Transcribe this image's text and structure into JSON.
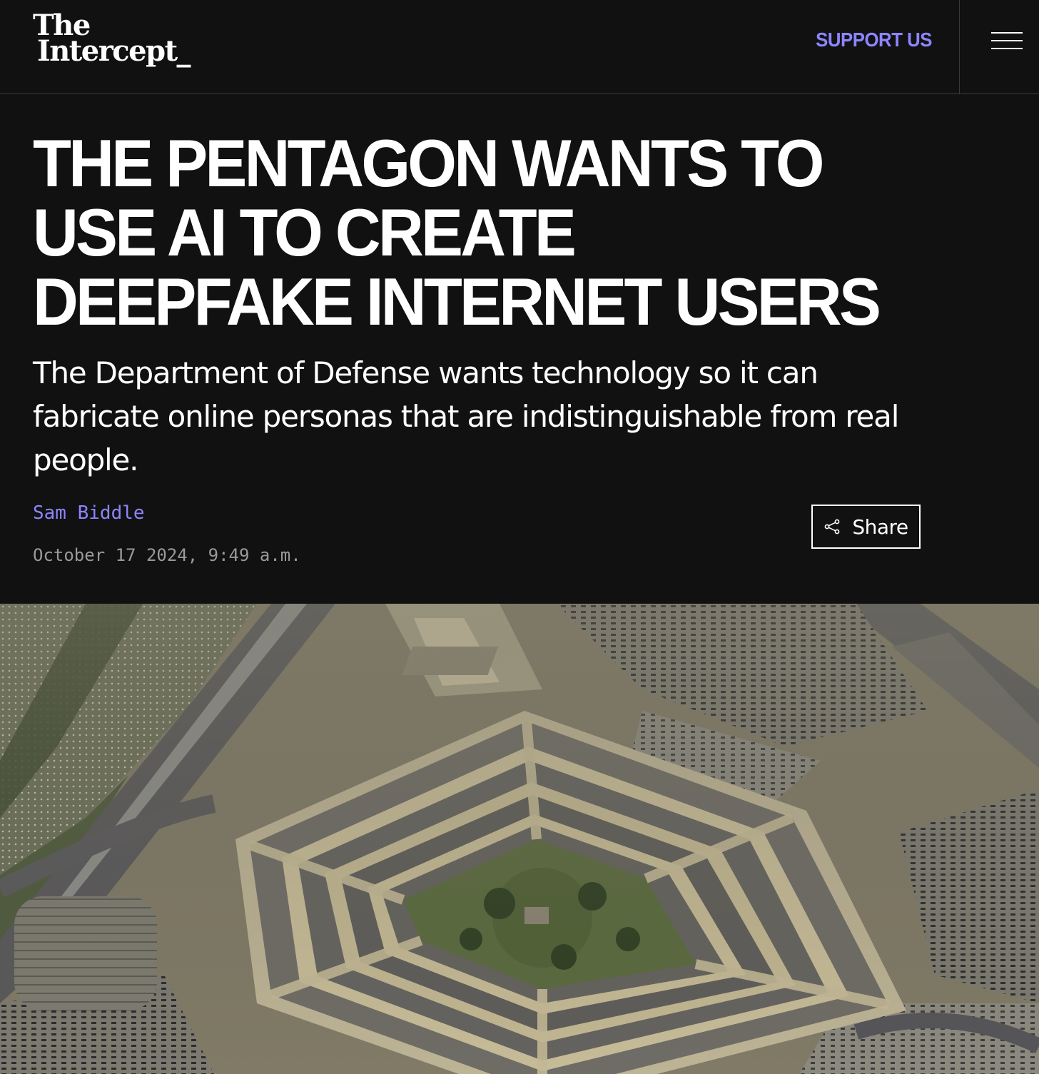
{
  "header": {
    "logo_line1": "The",
    "logo_line2": "Intercept_",
    "support_label": "SUPPORT US",
    "menu_icon": "hamburger-menu-icon"
  },
  "article": {
    "headline": "THE PENTAGON WANTS TO USE AI TO CREATE DEEPFAKE INTERNET USERS",
    "dek": "The Department of Defense wants technology so it can fabricate online personas that are indistinguishable from real people.",
    "author": "Sam Biddle",
    "date": "October 17 2024, 9:49 a.m.",
    "share_label": "Share",
    "share_icon": "share-icon"
  },
  "hero": {
    "subject": "aerial-photo-pentagon"
  },
  "colors": {
    "background": "#111111",
    "accent": "#8d85ff",
    "text": "#ffffff",
    "muted": "#9a9a9a"
  }
}
